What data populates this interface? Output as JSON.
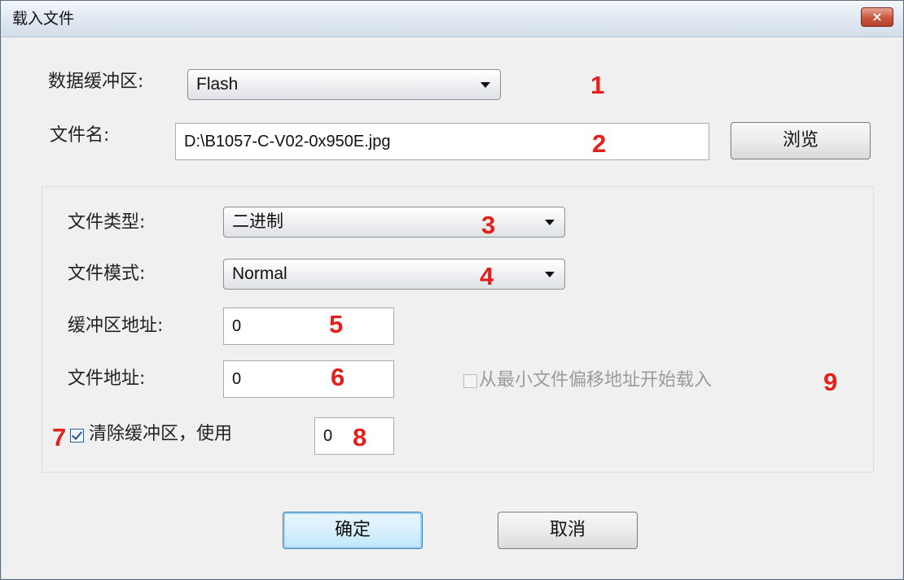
{
  "window": {
    "title": "载入文件",
    "close": "×"
  },
  "buffer": {
    "label": "数据缓冲区:",
    "value": "Flash",
    "marker": "1"
  },
  "filename": {
    "label": "文件名:",
    "value": "D:\\B1057-C-V02-0x950E.jpg",
    "marker": "2",
    "browse": "浏览"
  },
  "file_type": {
    "label": "文件类型:",
    "value": "二进制",
    "marker": "3"
  },
  "file_mode": {
    "label": "文件模式:",
    "value": "Normal",
    "marker": "4"
  },
  "buffer_address": {
    "label": "缓冲区地址:",
    "value": "0",
    "marker": "5"
  },
  "file_address": {
    "label": "文件地址:",
    "value": "0",
    "marker": "6"
  },
  "clear_buffer": {
    "marker": "7",
    "label": "清除缓冲区，使用",
    "checked": true,
    "value": "0",
    "value_marker": "8"
  },
  "min_offset": {
    "label": "从最小文件偏移地址开始载入",
    "checked": false,
    "marker": "9"
  },
  "buttons": {
    "ok": "确定",
    "cancel": "取消"
  }
}
